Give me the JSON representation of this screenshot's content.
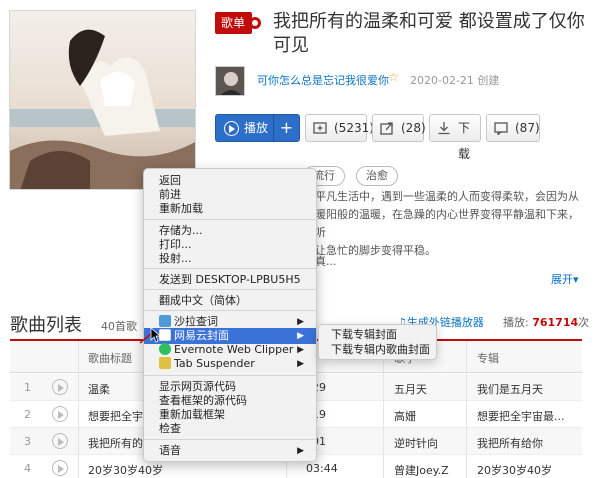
{
  "playlist": {
    "badge": "歌单",
    "title": "我把所有的温柔和可爱 都设置成了仅你可见",
    "creator": "可你怎么总是忘记我很爱你",
    "created": "2020-02-21 创建",
    "play_label": "播放",
    "plus_label": "+",
    "collect_label": "(5231)",
    "share_label": "(28)",
    "download_label": "下载",
    "comment_label": "(87)",
    "tags": [
      "流行",
      "治愈"
    ],
    "desc_line1": "平凡生活中，遇到一些温柔的人而变得柔软，会因为从",
    "desc_line2": "暖阳般的温暖，在急躁的内心世界变得平静温和下来，听",
    "desc_line3": "让急忙的脚步变得平稳。",
    "desc_line4": "真...",
    "expand_label": "展开▾"
  },
  "song_list": {
    "title": "歌曲列表",
    "count": "40首歌",
    "gen_link": "生成外链播放器",
    "plays_label": "播放:",
    "plays_value": "761714",
    "plays_unit": "次",
    "headers": {
      "title": "歌曲标题",
      "duration": "",
      "singer": "歌手",
      "album": "专辑"
    },
    "rows": [
      {
        "idx": "1",
        "title": "温柔",
        "duration": "29",
        "singer": "五月天",
        "album": "我们是五月天"
      },
      {
        "idx": "2",
        "title": "想要把全宇宙",
        "duration": "19",
        "singer": "高姗",
        "album": "想要把全宇宙最..."
      },
      {
        "idx": "3",
        "title": "我把所有的",
        "duration": "01",
        "singer": "逆时针向",
        "album": "我把所有给你"
      },
      {
        "idx": "4",
        "title": "20岁30岁40岁",
        "duration": "03:44",
        "singer": "曾建Joey.Z",
        "album": "20岁30岁40岁"
      }
    ]
  },
  "context_menu": {
    "back": "返回",
    "forward": "前进",
    "reload": "重新加载",
    "save_as": "存储为...",
    "print": "打印...",
    "cast": "投射...",
    "send_to": "发送到 DESKTOP-LPBU5H5",
    "translate": "翻成中文（简体）",
    "shaci": "沙拉查词",
    "netease_cover": "网易云封面",
    "evernote": "Evernote Web Clipper",
    "tab_suspender": "Tab Suspender",
    "view_source": "显示网页源代码",
    "view_frame_source": "查看框架的源代码",
    "reload_frame": "重新加载框架",
    "inspect": "检查",
    "speech": "语音",
    "arrow": "▶"
  },
  "submenu": {
    "item1": "下载专辑封面",
    "item2": "下载专辑内歌曲封面"
  },
  "colors": {
    "brand_red": "#c20c0c",
    "link_blue": "#0c73c2",
    "menu_highlight": "#3a72d8"
  }
}
